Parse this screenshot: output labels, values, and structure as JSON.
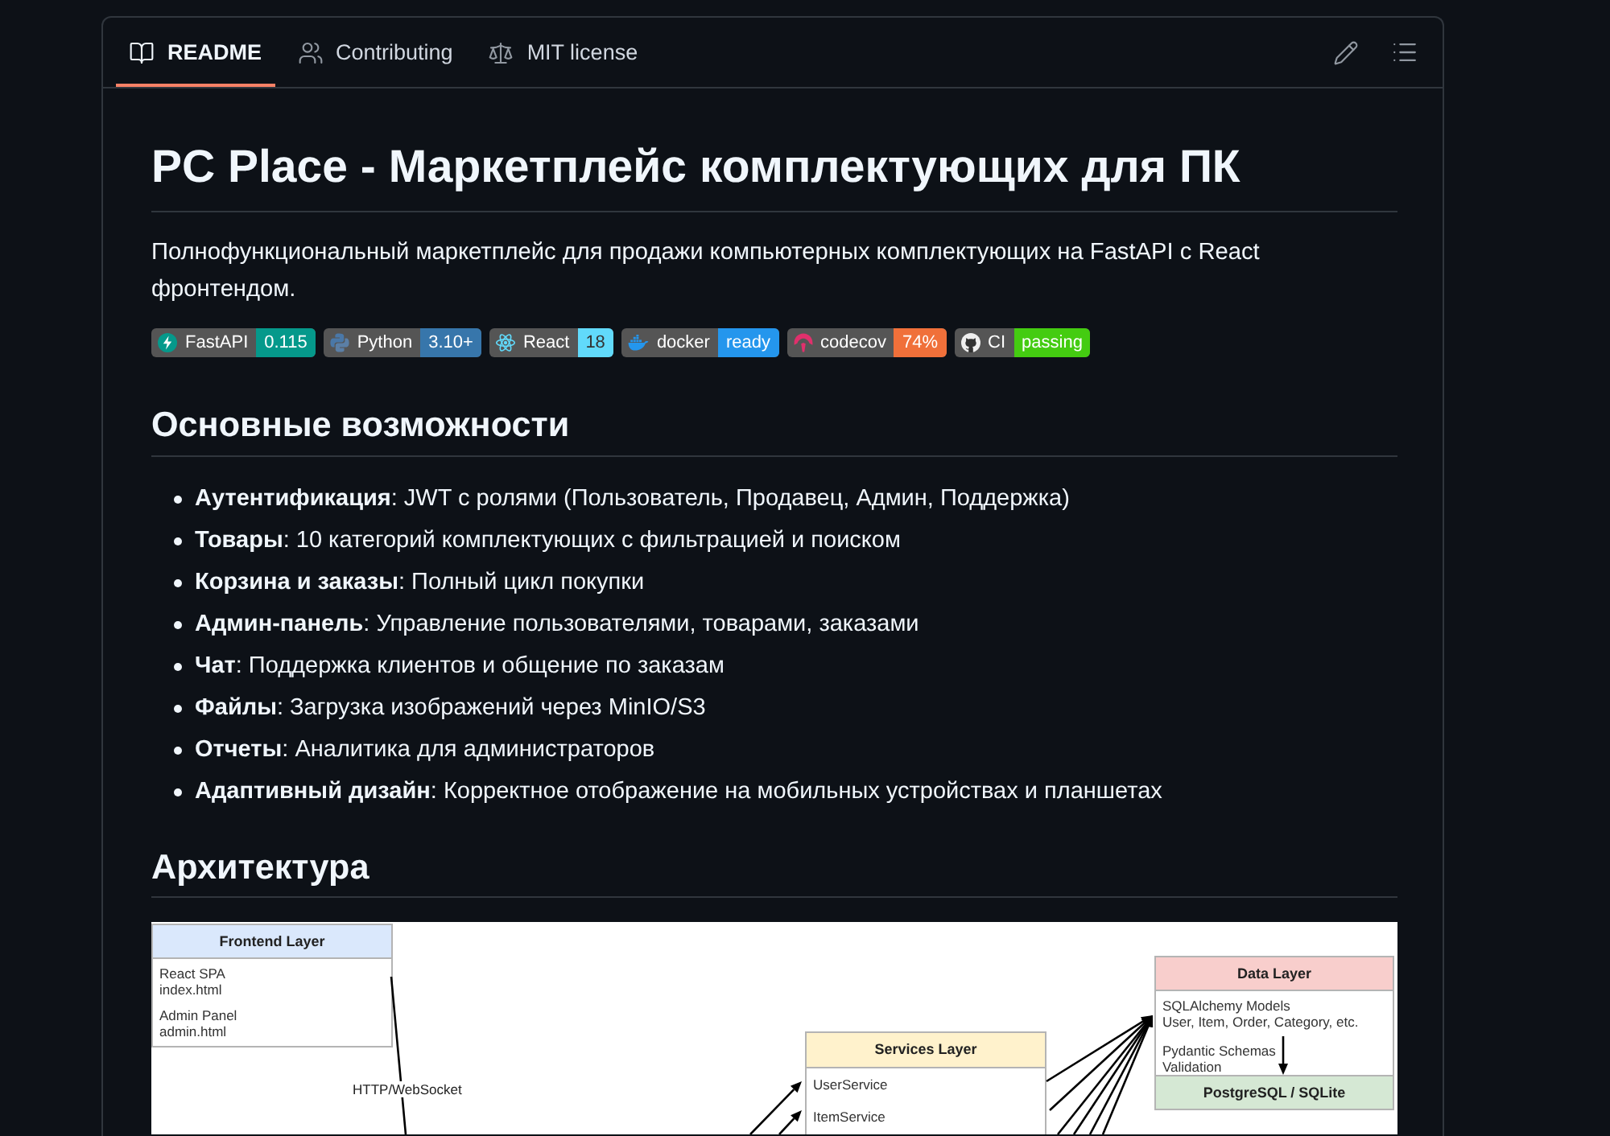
{
  "tabs": [
    {
      "kind": "readme",
      "label": "README",
      "selected": true
    },
    {
      "kind": "contributing",
      "label": "Contributing",
      "selected": false
    },
    {
      "kind": "license",
      "label": "MIT license",
      "selected": false
    }
  ],
  "readme": {
    "title": "PC Place - Маркетплейс комплектующих для ПК",
    "description": "Полнофункциональный маркетплейс для продажи компьютерных комплектующих на FastAPI с React фронтендом.",
    "badges": [
      {
        "kind": "fastapi",
        "label": "FastAPI",
        "value": "0.115",
        "color": "#05998b"
      },
      {
        "kind": "python",
        "label": "Python",
        "value": "3.10+",
        "color": "#3776ab"
      },
      {
        "kind": "react",
        "label": "React",
        "value": "18",
        "color": "#61dafb"
      },
      {
        "kind": "docker",
        "label": "docker",
        "value": "ready",
        "color": "#2496ed"
      },
      {
        "kind": "codecov",
        "label": "codecov",
        "value": "74%",
        "color": "#f0703a"
      },
      {
        "kind": "github",
        "label": "CI",
        "value": "passing",
        "color": "#44cc11"
      }
    ],
    "features_heading": "Основные возможности",
    "features": [
      "**Аутентификация**: JWT с ролями (Пользователь, Продавец, Админ, Поддержка)",
      "**Товары**: 10 категорий комплектующих с фильтрацией и поиском",
      "**Корзина и заказы**: Полный цикл покупки",
      "**Админ-панель**: Управление пользователями, товарами, заказами",
      "**Чат**: Поддержка клиентов и общение по заказам",
      "**Файлы**: Загрузка изображений через MinIO/S3",
      "**Отчеты**: Аналитика для администраторов",
      "**Адаптивный дизайн**: Корректное отображение на мобильных устройствах и планшетах"
    ],
    "architecture_heading": "Архитектура",
    "diagram": {
      "nodes": [
        {
          "title": "Frontend Layer",
          "color": "#dae8fc",
          "items": [
            {
              "name": "React SPA",
              "detail": "index.html"
            },
            {
              "name": "Admin Panel",
              "detail": "admin.html"
            }
          ]
        },
        {
          "title": "Services Layer",
          "color": "#fff2cc",
          "items": [
            {
              "name": "UserService"
            },
            {
              "name": "ItemService"
            }
          ]
        },
        {
          "title": "Data Layer",
          "color": "#f8cecc",
          "items": [
            {
              "name": "SQLAlchemy Models",
              "detail": "User, Item, Order, Category, etc."
            },
            {
              "name": "Pydantic Schemas",
              "detail": "Validation"
            }
          ],
          "footer": {
            "title": "PostgreSQL / SQLite",
            "color": "#d5e8d4"
          }
        }
      ],
      "connector_label": "HTTP/WebSocket"
    }
  }
}
